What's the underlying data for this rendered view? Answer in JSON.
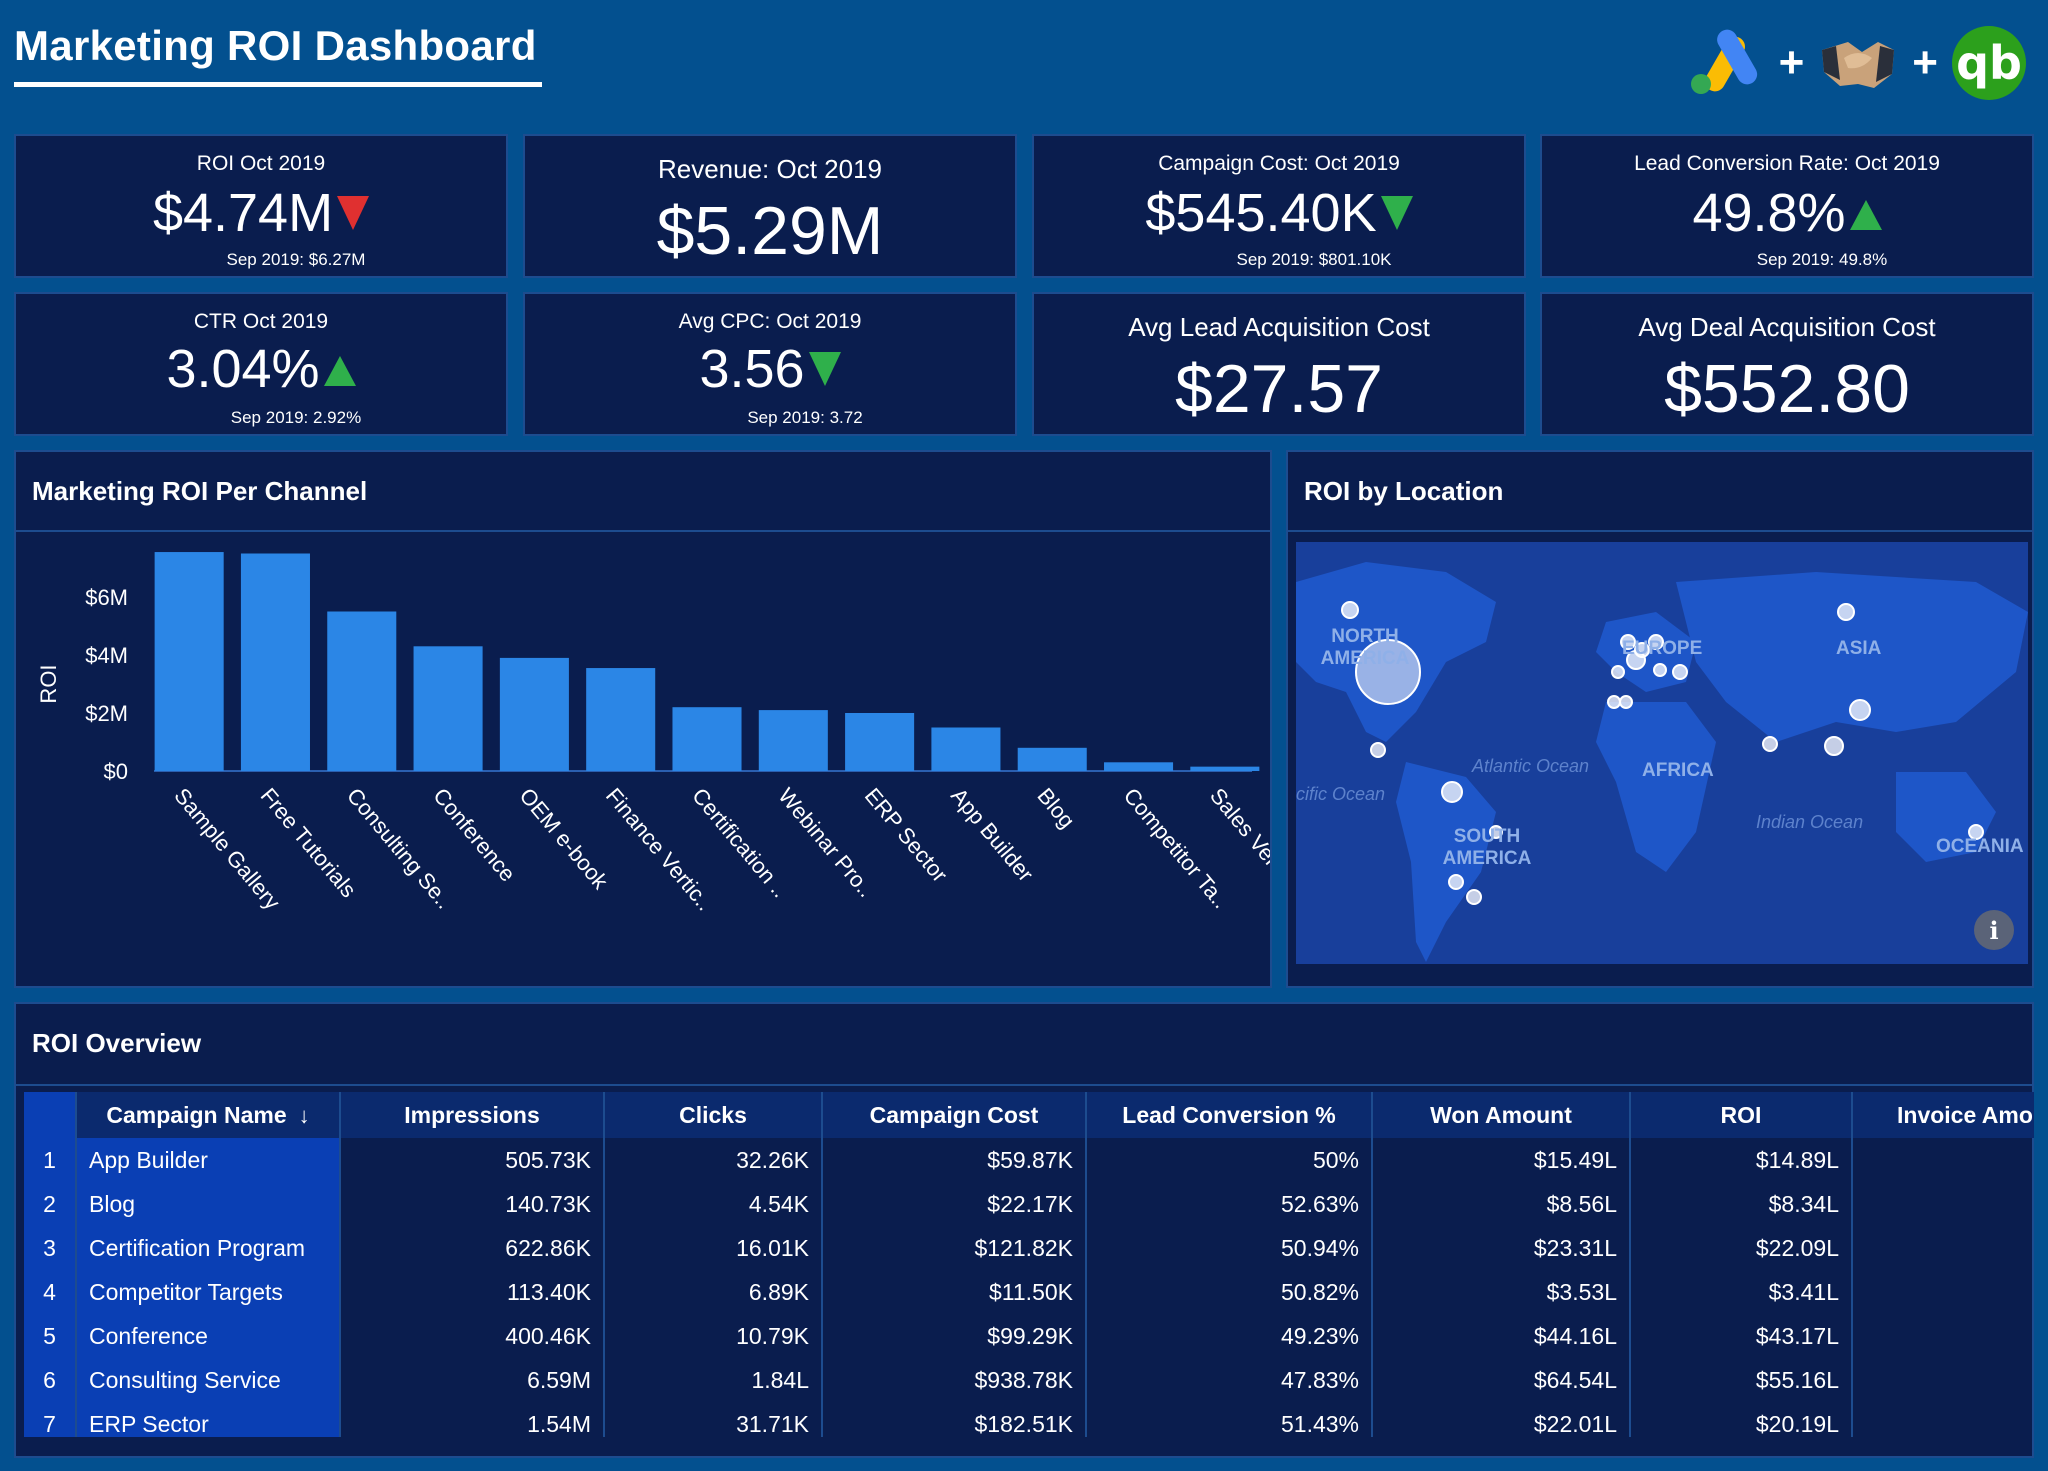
{
  "header": {
    "title": "Marketing ROI Dashboard",
    "logos": [
      {
        "name": "google-ads-logo",
        "icon": "google-ads"
      },
      {
        "name": "handshake-logo",
        "icon": "handshake"
      },
      {
        "name": "quickbooks-logo",
        "icon": "quickbooks",
        "text": "qb"
      }
    ],
    "plus": "+"
  },
  "kpis": {
    "roi": {
      "title": "ROI Oct 2019",
      "value": "$4.74M",
      "sub": "Sep 2019: $6.27M",
      "trend": "down",
      "trend_color": "#e03030"
    },
    "revenue": {
      "title": "Revenue: Oct 2019",
      "value": "$5.29M"
    },
    "campaign_cost": {
      "title": "Campaign Cost: Oct 2019",
      "value": "$545.40K",
      "sub": "Sep 2019: $801.10K",
      "trend": "down",
      "trend_color": "#2fb04b"
    },
    "lead_conv": {
      "title": "Lead Conversion Rate: Oct 2019",
      "value": "49.8%",
      "sub": "Sep 2019: 49.8%",
      "trend": "up",
      "trend_color": "#2fb04b"
    },
    "ctr": {
      "title": "CTR Oct 2019",
      "value": "3.04%",
      "sub": "Sep 2019: 2.92%",
      "trend": "up",
      "trend_color": "#2fb04b"
    },
    "cpc": {
      "title": "Avg CPC: Oct 2019",
      "value": "3.56",
      "sub": "Sep 2019: 3.72",
      "trend": "down",
      "trend_color": "#2fb04b"
    },
    "lead_acq": {
      "title": "Avg Lead Acquisition Cost",
      "value": "$27.57"
    },
    "deal_acq": {
      "title": "Avg Deal Acquisition Cost",
      "value": "$552.80"
    }
  },
  "chart_panel": {
    "title": "Marketing ROI Per Channel"
  },
  "chart_data": {
    "type": "bar",
    "title": "Marketing ROI Per Channel",
    "ylabel": "ROI",
    "xlabel": "",
    "categories": [
      "Sample Gallery",
      "Free Tutorials",
      "Consulting Se..",
      "Conference",
      "OEM e-book",
      "Finance Vertic..",
      "Certification ..",
      "Webinar Pro..",
      "ERP Sector",
      "App Builder",
      "Blog",
      "Competitor Ta..",
      "Sales Ver.."
    ],
    "values": [
      7.55,
      7.5,
      5.5,
      4.3,
      3.9,
      3.55,
      2.2,
      2.1,
      2.0,
      1.5,
      0.8,
      0.3,
      0.15
    ],
    "yticks": [
      "$0",
      "$2M",
      "$4M",
      "$6M"
    ],
    "ytick_values": [
      0,
      2,
      4,
      6
    ],
    "ylim": [
      0,
      8
    ],
    "units": "$M",
    "bar_color": "#2b86e6",
    "grid": false
  },
  "map_panel": {
    "title": "ROI by Location",
    "labels": {
      "north_america": "NORTH AMERICA",
      "south_america": "SOUTH AMERICA",
      "europe": "EUROPE",
      "asia": "ASIA",
      "africa": "AFRICA",
      "oceania": "OCEANIA",
      "atlantic": "Atlantic Ocean",
      "pacific": "cific Ocean",
      "indian": "Indian Ocean"
    },
    "info_icon": "i"
  },
  "table_panel": {
    "title": "ROI Overview",
    "columns": [
      "",
      "Campaign Name",
      "Impressions",
      "Clicks",
      "Campaign Cost",
      "Lead Conversion %",
      "Won Amount",
      "ROI",
      "Invoice Amo"
    ],
    "sort_icon": "↓",
    "rows": [
      {
        "idx": "1",
        "name": "App Builder",
        "impressions": "505.73K",
        "clicks": "32.26K",
        "cost": "$59.87K",
        "conv": "50%",
        "won": "$15.49L",
        "roi": "$14.89L",
        "invoice": "$"
      },
      {
        "idx": "2",
        "name": "Blog",
        "impressions": "140.73K",
        "clicks": "4.54K",
        "cost": "$22.17K",
        "conv": "52.63%",
        "won": "$8.56L",
        "roi": "$8.34L",
        "invoice": ""
      },
      {
        "idx": "3",
        "name": "Certification Program",
        "impressions": "622.86K",
        "clicks": "16.01K",
        "cost": "$121.82K",
        "conv": "50.94%",
        "won": "$23.31L",
        "roi": "$22.09L",
        "invoice": "$"
      },
      {
        "idx": "4",
        "name": "Competitor Targets",
        "impressions": "113.40K",
        "clicks": "6.89K",
        "cost": "$11.50K",
        "conv": "50.82%",
        "won": "$3.53L",
        "roi": "$3.41L",
        "invoice": ""
      },
      {
        "idx": "5",
        "name": "Conference",
        "impressions": "400.46K",
        "clicks": "10.79K",
        "cost": "$99.29K",
        "conv": "49.23%",
        "won": "$44.16L",
        "roi": "$43.17L",
        "invoice": "$"
      },
      {
        "idx": "6",
        "name": "Consulting Service",
        "impressions": "6.59M",
        "clicks": "1.84L",
        "cost": "$938.78K",
        "conv": "47.83%",
        "won": "$64.54L",
        "roi": "$55.16L",
        "invoice": "$"
      },
      {
        "idx": "7",
        "name": "ERP Sector",
        "impressions": "1.54M",
        "clicks": "31.71K",
        "cost": "$182.51K",
        "conv": "51.43%",
        "won": "$22.01L",
        "roi": "$20.19L",
        "invoice": ""
      }
    ]
  }
}
